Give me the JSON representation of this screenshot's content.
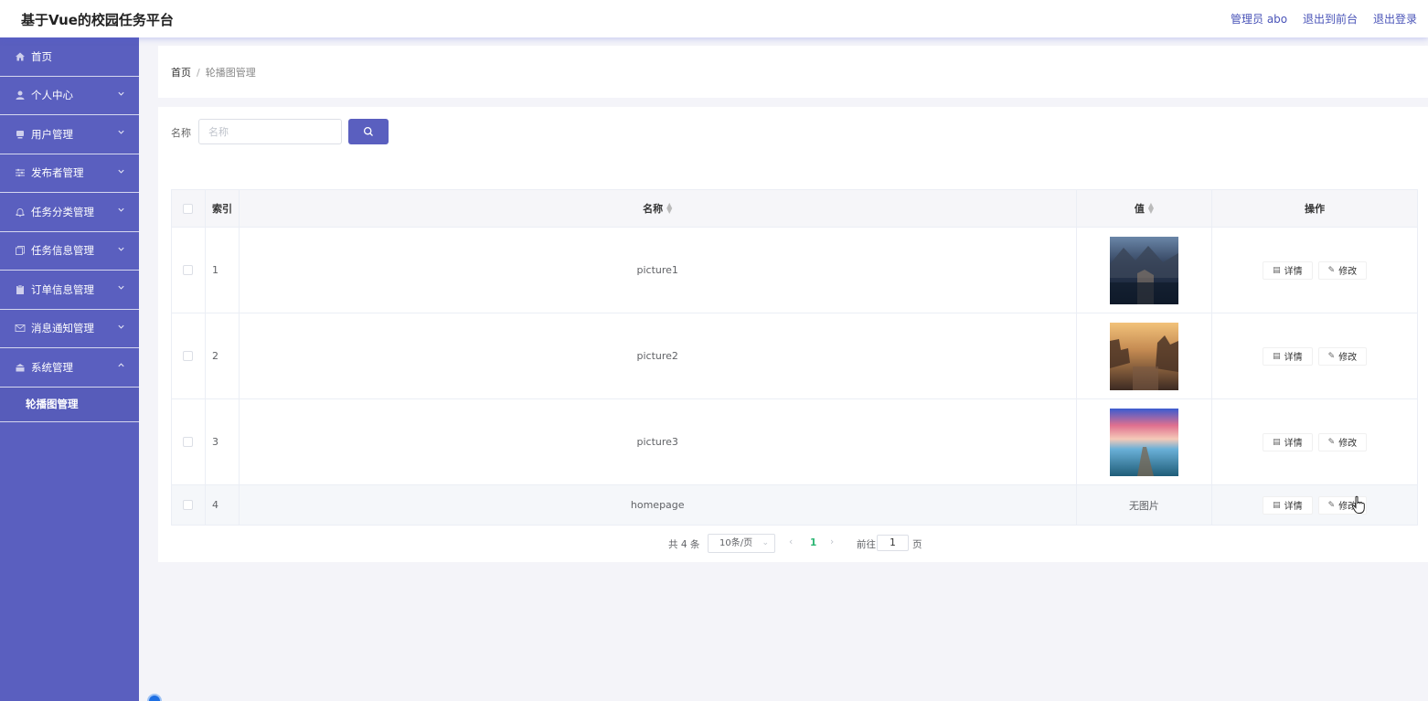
{
  "header": {
    "app_title": "基于Vue的校园任务平台",
    "user_label": "管理员 abo",
    "goto_front_label": "退出到前台",
    "logout_label": "退出登录"
  },
  "sidebar": {
    "items": [
      {
        "label": "首页",
        "icon": "home-icon",
        "has_chevron": false
      },
      {
        "label": "个人中心",
        "icon": "user-icon",
        "has_chevron": true
      },
      {
        "label": "用户管理",
        "icon": "users-icon",
        "has_chevron": true
      },
      {
        "label": "发布者管理",
        "icon": "sliders-icon",
        "has_chevron": true
      },
      {
        "label": "任务分类管理",
        "icon": "bell-icon",
        "has_chevron": true
      },
      {
        "label": "任务信息管理",
        "icon": "copy-icon",
        "has_chevron": true
      },
      {
        "label": "订单信息管理",
        "icon": "clipboard-icon",
        "has_chevron": true
      },
      {
        "label": "消息通知管理",
        "icon": "mail-icon",
        "has_chevron": true
      },
      {
        "label": "系统管理",
        "icon": "box-icon",
        "has_chevron": true,
        "expanded": true
      }
    ],
    "sub_items": [
      {
        "label": "轮播图管理"
      }
    ]
  },
  "breadcrumb": {
    "home": "首页",
    "separator": "/",
    "current": "轮播图管理"
  },
  "search": {
    "label": "名称",
    "placeholder": "名称",
    "value": ""
  },
  "table": {
    "columns": [
      "索引",
      "名称",
      "值",
      "操作"
    ],
    "rows": [
      {
        "index": "1",
        "name": "picture1",
        "value_type": "image",
        "image_name": "mountain-lake-image"
      },
      {
        "index": "2",
        "name": "picture2",
        "value_type": "image",
        "image_name": "sunset-town-image"
      },
      {
        "index": "3",
        "name": "picture3",
        "value_type": "image",
        "image_name": "pier-sky-image"
      },
      {
        "index": "4",
        "name": "homepage",
        "value_type": "text",
        "value_text": "无图片"
      }
    ],
    "detail_label": "详情",
    "edit_label": "修改"
  },
  "pagination": {
    "total_label": "共 4 条",
    "page_size_label": "10条/页",
    "current_page": "1",
    "goto_label": "前往",
    "goto_value": "1",
    "page_unit": "页"
  },
  "colors": {
    "accent": "#5a5fbf",
    "header_link": "#4a54b8",
    "active_page": "#2bb673"
  }
}
